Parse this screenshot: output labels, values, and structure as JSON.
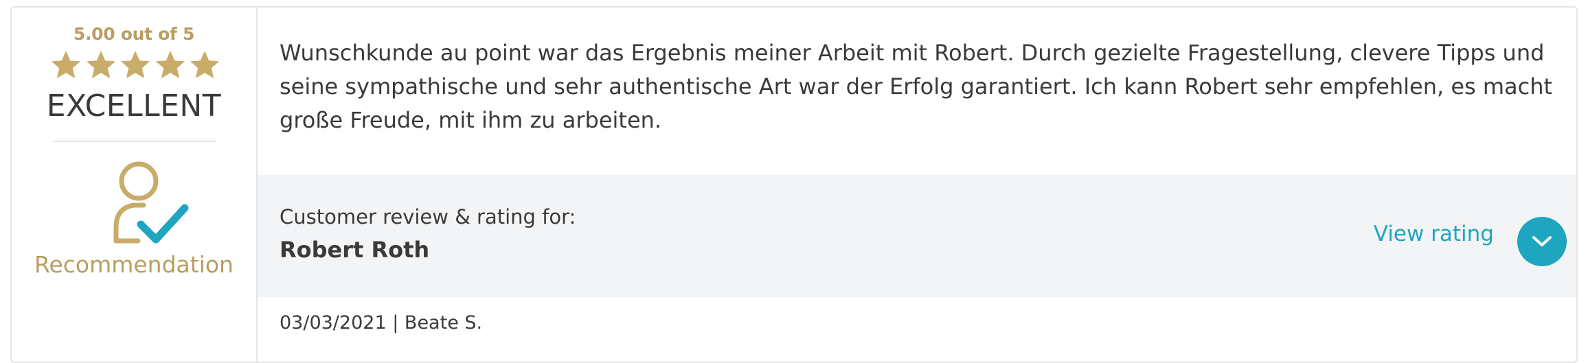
{
  "rating": {
    "score_text": "5.00 out of 5",
    "stars": 5,
    "max_stars": 5,
    "verdict": "EXCELLENT",
    "star_color": "#c9ac6a"
  },
  "recommendation": {
    "icon": "user-check-icon",
    "label": "Recommendation"
  },
  "review": {
    "text": "Wunschkunde au point war das Ergebnis meiner Arbeit mit Robert. Durch gezielte Fragestellung, clevere Tipps und seine sympathische und sehr authentische Art war der Erfolg garantiert. Ich kann Robert sehr empfehlen, es macht große Freude, mit ihm zu arbeiten.",
    "review_for_label": "Customer review & rating for:",
    "reviewee": "Robert Roth",
    "view_rating_label": "View rating",
    "view_rating_icon": "chevron-down-icon",
    "date": "03/03/2021",
    "separator": "|",
    "author": "Beate S."
  },
  "colors": {
    "gold": "#b99e62",
    "accent": "#1ea5c0",
    "band": "#f3f4f5",
    "text": "#3a3a3a"
  }
}
